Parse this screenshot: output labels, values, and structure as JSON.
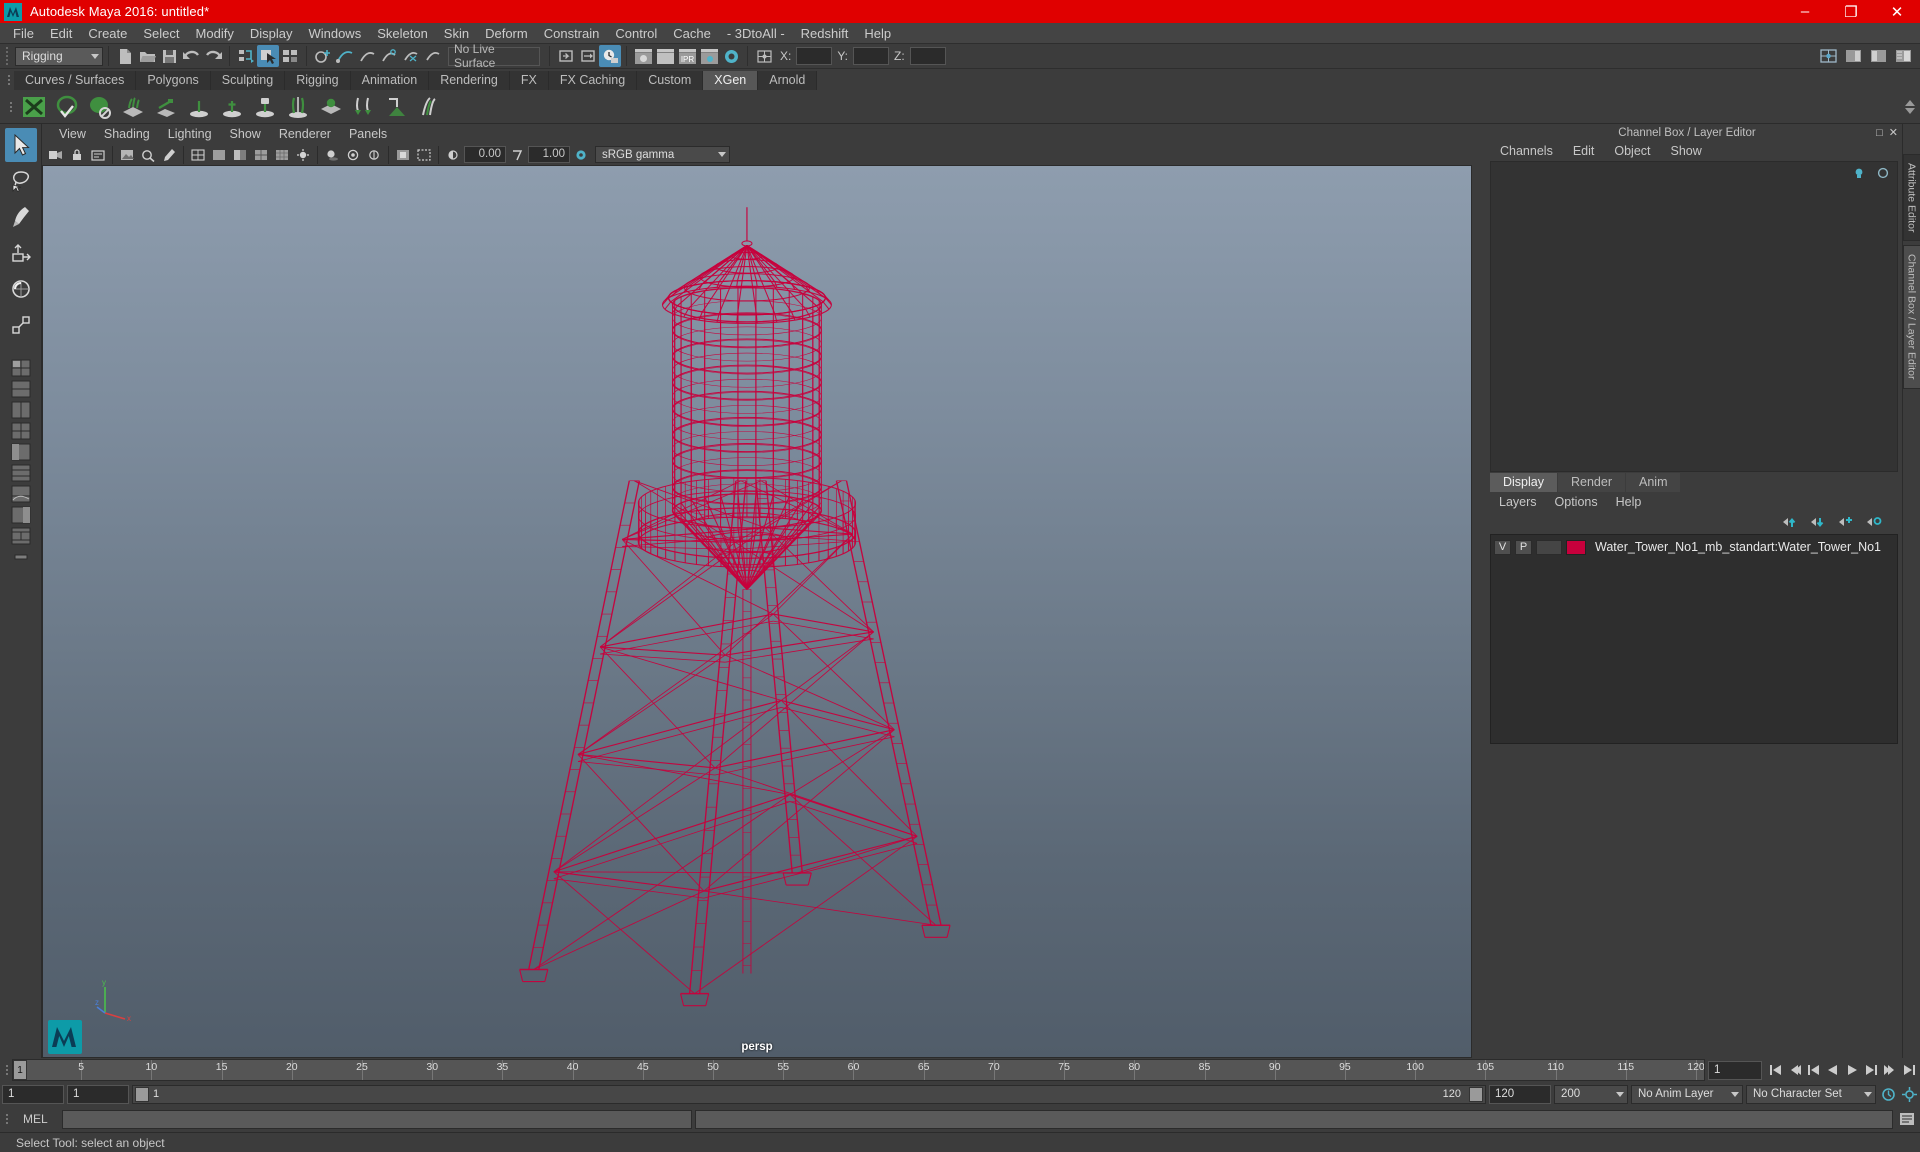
{
  "window": {
    "title": "Autodesk Maya 2016: untitled*",
    "minimize": "–",
    "maximize": "❐",
    "close": "✕",
    "title_bar_color": "#e00000"
  },
  "menubar": {
    "items": [
      {
        "label": "File"
      },
      {
        "label": "Edit"
      },
      {
        "label": "Create"
      },
      {
        "label": "Select"
      },
      {
        "label": "Modify"
      },
      {
        "label": "Display"
      },
      {
        "label": "Windows"
      },
      {
        "label": "Skeleton"
      },
      {
        "label": "Skin"
      },
      {
        "label": "Deform"
      },
      {
        "label": "Constrain"
      },
      {
        "label": "Control"
      },
      {
        "label": "Cache"
      },
      {
        "label": "- 3DtoAll -"
      },
      {
        "label": "Redshift"
      },
      {
        "label": "Help"
      }
    ]
  },
  "statusbar": {
    "mode": "Rigging",
    "live_surface": "No Live Surface",
    "coord_x_label": "X:",
    "coord_y_label": "Y:",
    "coord_z_label": "Z:",
    "coord_x_value": "",
    "coord_y_value": "",
    "coord_z_value": ""
  },
  "shelf": {
    "tabs": [
      {
        "label": "Curves / Surfaces",
        "active": false
      },
      {
        "label": "Polygons",
        "active": false
      },
      {
        "label": "Sculpting",
        "active": false
      },
      {
        "label": "Rigging",
        "active": false
      },
      {
        "label": "Animation",
        "active": false
      },
      {
        "label": "Rendering",
        "active": false
      },
      {
        "label": "FX",
        "active": false
      },
      {
        "label": "FX Caching",
        "active": false
      },
      {
        "label": "Custom",
        "active": false
      },
      {
        "label": "XGen",
        "active": true
      },
      {
        "label": "Arnold",
        "active": false
      }
    ]
  },
  "panel": {
    "menus": [
      {
        "label": "View"
      },
      {
        "label": "Shading"
      },
      {
        "label": "Lighting"
      },
      {
        "label": "Show"
      },
      {
        "label": "Renderer"
      },
      {
        "label": "Panels"
      }
    ],
    "exposure_value": "0.00",
    "gamma_value": "1.00",
    "color_profile": "sRGB gamma",
    "camera_label": "persp",
    "axis_x": "x",
    "axis_y": "y",
    "axis_z": "z",
    "model_color": "#c7003c",
    "background_top": "#8e9dae",
    "background_bottom": "#515d6a"
  },
  "right_dock": {
    "title": "Channel Box / Layer Editor",
    "channelbox_menus": [
      {
        "label": "Channels"
      },
      {
        "label": "Edit"
      },
      {
        "label": "Object"
      },
      {
        "label": "Show"
      }
    ],
    "layer_tabs": [
      {
        "label": "Display",
        "active": true
      },
      {
        "label": "Render",
        "active": false
      },
      {
        "label": "Anim",
        "active": false
      }
    ],
    "layer_menus": [
      {
        "label": "Layers"
      },
      {
        "label": "Options"
      },
      {
        "label": "Help"
      }
    ],
    "layers": [
      {
        "visibility": "V",
        "playback": "P",
        "color": "#c7003c",
        "name": "Water_Tower_No1_mb_standart:Water_Tower_No1"
      }
    ],
    "vertical_tabs": [
      {
        "label": "Attribute Editor",
        "active": false
      },
      {
        "label": "Channel Box / Layer Editor",
        "active": true
      }
    ]
  },
  "timeslider": {
    "current_frame": "1",
    "ticks": [
      {
        "label": "5",
        "frame": 5
      },
      {
        "label": "10",
        "frame": 10
      },
      {
        "label": "15",
        "frame": 15
      },
      {
        "label": "20",
        "frame": 20
      },
      {
        "label": "25",
        "frame": 25
      },
      {
        "label": "30",
        "frame": 30
      },
      {
        "label": "35",
        "frame": 35
      },
      {
        "label": "40",
        "frame": 40
      },
      {
        "label": "45",
        "frame": 45
      },
      {
        "label": "50",
        "frame": 50
      },
      {
        "label": "55",
        "frame": 55
      },
      {
        "label": "60",
        "frame": 60
      },
      {
        "label": "65",
        "frame": 65
      },
      {
        "label": "70",
        "frame": 70
      },
      {
        "label": "75",
        "frame": 75
      },
      {
        "label": "80",
        "frame": 80
      },
      {
        "label": "85",
        "frame": 85
      },
      {
        "label": "90",
        "frame": 90
      },
      {
        "label": "95",
        "frame": 95
      },
      {
        "label": "100",
        "frame": 100
      },
      {
        "label": "105",
        "frame": 105
      },
      {
        "label": "110",
        "frame": 110
      },
      {
        "label": "115",
        "frame": 115
      },
      {
        "label": "120",
        "frame": 120
      }
    ],
    "range_start": 1,
    "range_end": 120,
    "key_field": "1"
  },
  "rangeslider": {
    "anim_start": "1",
    "anim_end": "1",
    "slider_left_label": "1",
    "slider_right_label": "120",
    "playback_end": "120",
    "anim_total_end": "200",
    "anim_layer": "No Anim Layer",
    "character_set": "No Character Set"
  },
  "commandline": {
    "language": "MEL",
    "input_value": "",
    "output_value": ""
  },
  "helpline": {
    "text": "Select Tool: select an object"
  }
}
